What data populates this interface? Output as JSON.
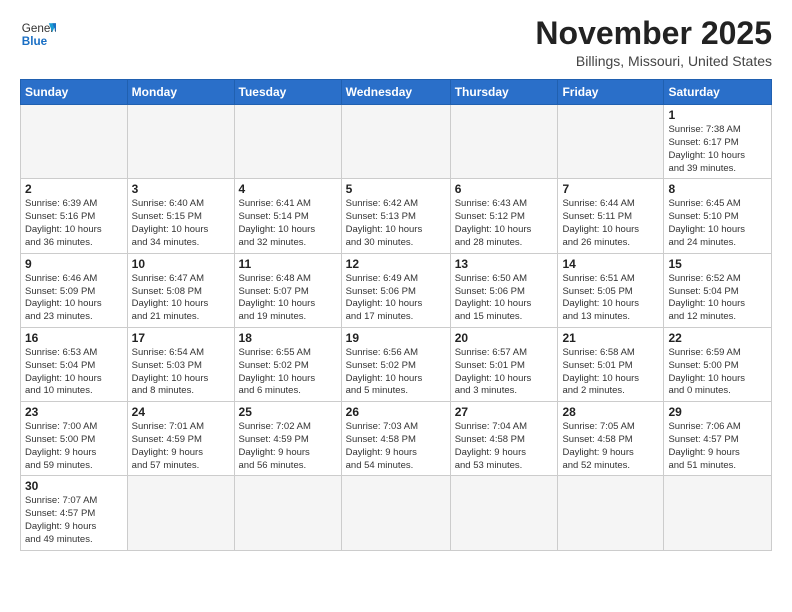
{
  "header": {
    "logo_general": "General",
    "logo_blue": "Blue",
    "month_title": "November 2025",
    "location": "Billings, Missouri, United States"
  },
  "days_of_week": [
    "Sunday",
    "Monday",
    "Tuesday",
    "Wednesday",
    "Thursday",
    "Friday",
    "Saturday"
  ],
  "weeks": [
    [
      {
        "day": "",
        "info": ""
      },
      {
        "day": "",
        "info": ""
      },
      {
        "day": "",
        "info": ""
      },
      {
        "day": "",
        "info": ""
      },
      {
        "day": "",
        "info": ""
      },
      {
        "day": "",
        "info": ""
      },
      {
        "day": "1",
        "info": "Sunrise: 7:38 AM\nSunset: 6:17 PM\nDaylight: 10 hours\nand 39 minutes."
      }
    ],
    [
      {
        "day": "2",
        "info": "Sunrise: 6:39 AM\nSunset: 5:16 PM\nDaylight: 10 hours\nand 36 minutes."
      },
      {
        "day": "3",
        "info": "Sunrise: 6:40 AM\nSunset: 5:15 PM\nDaylight: 10 hours\nand 34 minutes."
      },
      {
        "day": "4",
        "info": "Sunrise: 6:41 AM\nSunset: 5:14 PM\nDaylight: 10 hours\nand 32 minutes."
      },
      {
        "day": "5",
        "info": "Sunrise: 6:42 AM\nSunset: 5:13 PM\nDaylight: 10 hours\nand 30 minutes."
      },
      {
        "day": "6",
        "info": "Sunrise: 6:43 AM\nSunset: 5:12 PM\nDaylight: 10 hours\nand 28 minutes."
      },
      {
        "day": "7",
        "info": "Sunrise: 6:44 AM\nSunset: 5:11 PM\nDaylight: 10 hours\nand 26 minutes."
      },
      {
        "day": "8",
        "info": "Sunrise: 6:45 AM\nSunset: 5:10 PM\nDaylight: 10 hours\nand 24 minutes."
      }
    ],
    [
      {
        "day": "9",
        "info": "Sunrise: 6:46 AM\nSunset: 5:09 PM\nDaylight: 10 hours\nand 23 minutes."
      },
      {
        "day": "10",
        "info": "Sunrise: 6:47 AM\nSunset: 5:08 PM\nDaylight: 10 hours\nand 21 minutes."
      },
      {
        "day": "11",
        "info": "Sunrise: 6:48 AM\nSunset: 5:07 PM\nDaylight: 10 hours\nand 19 minutes."
      },
      {
        "day": "12",
        "info": "Sunrise: 6:49 AM\nSunset: 5:06 PM\nDaylight: 10 hours\nand 17 minutes."
      },
      {
        "day": "13",
        "info": "Sunrise: 6:50 AM\nSunset: 5:06 PM\nDaylight: 10 hours\nand 15 minutes."
      },
      {
        "day": "14",
        "info": "Sunrise: 6:51 AM\nSunset: 5:05 PM\nDaylight: 10 hours\nand 13 minutes."
      },
      {
        "day": "15",
        "info": "Sunrise: 6:52 AM\nSunset: 5:04 PM\nDaylight: 10 hours\nand 12 minutes."
      }
    ],
    [
      {
        "day": "16",
        "info": "Sunrise: 6:53 AM\nSunset: 5:04 PM\nDaylight: 10 hours\nand 10 minutes."
      },
      {
        "day": "17",
        "info": "Sunrise: 6:54 AM\nSunset: 5:03 PM\nDaylight: 10 hours\nand 8 minutes."
      },
      {
        "day": "18",
        "info": "Sunrise: 6:55 AM\nSunset: 5:02 PM\nDaylight: 10 hours\nand 6 minutes."
      },
      {
        "day": "19",
        "info": "Sunrise: 6:56 AM\nSunset: 5:02 PM\nDaylight: 10 hours\nand 5 minutes."
      },
      {
        "day": "20",
        "info": "Sunrise: 6:57 AM\nSunset: 5:01 PM\nDaylight: 10 hours\nand 3 minutes."
      },
      {
        "day": "21",
        "info": "Sunrise: 6:58 AM\nSunset: 5:01 PM\nDaylight: 10 hours\nand 2 minutes."
      },
      {
        "day": "22",
        "info": "Sunrise: 6:59 AM\nSunset: 5:00 PM\nDaylight: 10 hours\nand 0 minutes."
      }
    ],
    [
      {
        "day": "23",
        "info": "Sunrise: 7:00 AM\nSunset: 5:00 PM\nDaylight: 9 hours\nand 59 minutes."
      },
      {
        "day": "24",
        "info": "Sunrise: 7:01 AM\nSunset: 4:59 PM\nDaylight: 9 hours\nand 57 minutes."
      },
      {
        "day": "25",
        "info": "Sunrise: 7:02 AM\nSunset: 4:59 PM\nDaylight: 9 hours\nand 56 minutes."
      },
      {
        "day": "26",
        "info": "Sunrise: 7:03 AM\nSunset: 4:58 PM\nDaylight: 9 hours\nand 54 minutes."
      },
      {
        "day": "27",
        "info": "Sunrise: 7:04 AM\nSunset: 4:58 PM\nDaylight: 9 hours\nand 53 minutes."
      },
      {
        "day": "28",
        "info": "Sunrise: 7:05 AM\nSunset: 4:58 PM\nDaylight: 9 hours\nand 52 minutes."
      },
      {
        "day": "29",
        "info": "Sunrise: 7:06 AM\nSunset: 4:57 PM\nDaylight: 9 hours\nand 51 minutes."
      }
    ],
    [
      {
        "day": "30",
        "info": "Sunrise: 7:07 AM\nSunset: 4:57 PM\nDaylight: 9 hours\nand 49 minutes."
      },
      {
        "day": "",
        "info": ""
      },
      {
        "day": "",
        "info": ""
      },
      {
        "day": "",
        "info": ""
      },
      {
        "day": "",
        "info": ""
      },
      {
        "day": "",
        "info": ""
      },
      {
        "day": "",
        "info": ""
      }
    ]
  ]
}
